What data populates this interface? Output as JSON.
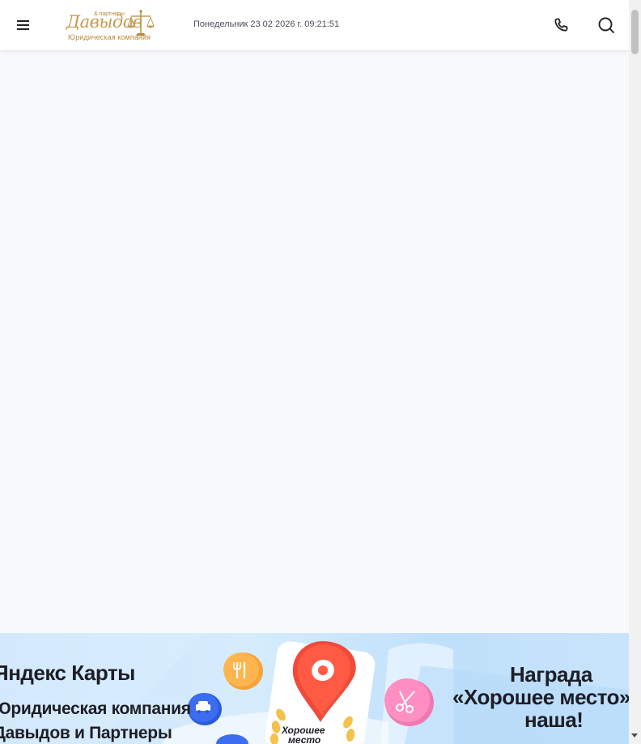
{
  "header": {
    "logo": {
      "partners": "& партнеры",
      "name": "Давыдов",
      "tagline": "Юридическая компания"
    },
    "datetime": "Понедельник 23 02 2026 г. 09:21:51",
    "icons": {
      "menu": "menu-icon",
      "phone": "phone-icon",
      "search": "search-icon"
    }
  },
  "banner": {
    "left_title": "Яндекс Карты",
    "left_line1": "Юридическая компания",
    "left_line2": "Давыдов и Партнеры",
    "pin_label_line1": "Хорошее",
    "pin_label_line2": "место",
    "right_line1": "Награда",
    "right_line2": "«Хорошее место»",
    "right_line3": "наша!"
  },
  "colors": {
    "header_bg": "#ffffff",
    "page_bg": "#f8f9fb",
    "logo_gold": "#c59a4c",
    "banner_bg": "#cfe6fb",
    "pin_red": "#f04a3b"
  }
}
